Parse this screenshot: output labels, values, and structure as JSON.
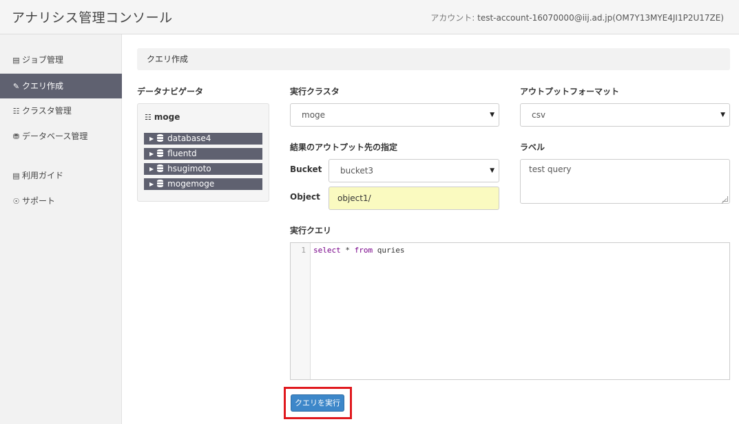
{
  "app": {
    "title": "アナリシス管理コンソール",
    "account_label": "アカウント: ",
    "account_value": "test-account-16070000@iij.ad.jp(OM7Y13MYE4JI1P2U17ZE)"
  },
  "sidebar": {
    "items": [
      {
        "label": "ジョブ管理",
        "icon": "list-icon",
        "active": false
      },
      {
        "label": "クエリ作成",
        "icon": "edit-icon",
        "active": true
      },
      {
        "label": "クラスタ管理",
        "icon": "sitemap-icon",
        "active": false
      },
      {
        "label": "データベース管理",
        "icon": "database-icon",
        "active": false
      },
      {
        "label": "利用ガイド",
        "icon": "book-icon",
        "active": false
      },
      {
        "label": "サポート",
        "icon": "lifebuoy-icon",
        "active": false
      }
    ]
  },
  "breadcrumb": {
    "label": "クエリ作成"
  },
  "navigator": {
    "title": "データナビゲータ",
    "root": "moge",
    "databases": [
      "database4",
      "fluentd",
      "hsugimoto",
      "mogemoge"
    ]
  },
  "form": {
    "cluster_label": "実行クラスタ",
    "cluster_value": "moge",
    "format_label": "アウトプットフォーマット",
    "format_value": "csv",
    "output_dest_label": "結果のアウトプット先の指定",
    "bucket_label": "Bucket",
    "bucket_value": "bucket3",
    "object_label": "Object",
    "object_value": "object1/",
    "label_label": "ラベル",
    "label_value": "test query",
    "query_label": "実行クエリ",
    "query_line_no": "1",
    "query_kw1": "select",
    "query_mid": " * ",
    "query_kw2": "from",
    "query_end": " quries",
    "run_button": "クエリを実行"
  },
  "colors": {
    "sidebar_active": "#5f6170",
    "button_primary": "#3d87c9",
    "highlight_border": "#e0191e",
    "object_input_bg": "#fafac0"
  }
}
